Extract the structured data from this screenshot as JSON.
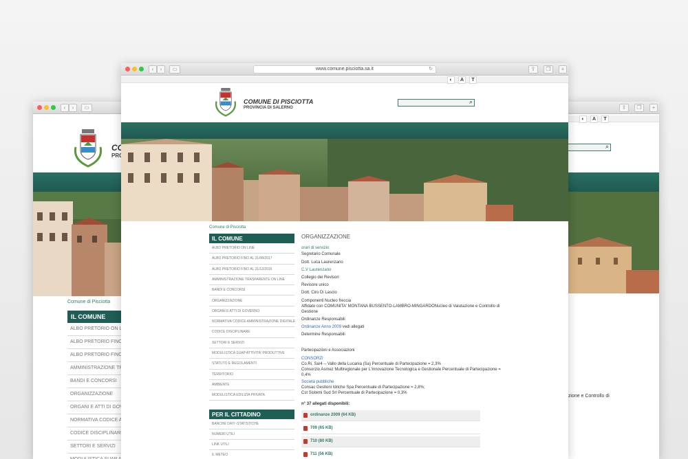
{
  "colors": {
    "accent": "#1e5e54",
    "teal": "#2b6f63",
    "link": "#2f7a6c",
    "link_blue": "#3567b5",
    "pdf": "#c23b2e"
  },
  "browser": {
    "url": "www.comune.pisciotta.sa.it",
    "reload_icon": "reload-icon",
    "share_icon": "share-icon",
    "tabs_icon": "tabs-icon",
    "new_tab_icon": "plus-icon"
  },
  "accessibility": {
    "contrast": "◐",
    "font": "A",
    "text": "T"
  },
  "header": {
    "title": "COMUNE DI PISCIOTTA",
    "subtitle": "PROVINCIA DI SALERNO"
  },
  "breadcrumb": "Comune di Pisciotta",
  "sidebar": {
    "heading": "IL COMUNE",
    "items": [
      "ALBO PRETORIO ON LINE",
      "ALBO PRETORIO FINO AL 31/08/2017",
      "ALBO PRETORIO FINO AL 31/12/2016",
      "AMMINISTRAZIONE TRASPARENTE ON LINE",
      "BANDI E CONCORSI",
      "ORGANIZZAZIONE",
      "ORGANI E ATTI DI GOVERNO",
      "NORMATIVA CODICE AMMINISTRAZIONE DIGITALE",
      "CODICE DISCIPLINARE",
      "SETTORI E SERVIZI",
      "MODULISTICA SUAP ATTIVITA' PRODUTTIVE",
      "STATUTO E REGOLAMENTI",
      "TERRITORIO",
      "AMBIENTE",
      "MODULISTICA EDILIZIA PRIVATA"
    ],
    "heading2": "PER IL CITTADINO",
    "items2": [
      "BANCHE DATI -STATISTICHE",
      "NUMERI UTILI",
      "LINK UTILI",
      "IL METEO"
    ]
  },
  "back_sidebar": {
    "heading": "IL COMUNE",
    "items": [
      "ALBO PRETORIO ON LINE",
      "ALBO PRETORIO FINO AL 31",
      "ALBO PRETORIO FINO AL 31",
      "AMMINISTRAZIONE TRASPA",
      "BANDI E CONCORSI",
      "ORGANIZZAZIONE",
      "ORGANI E ATTI DI GOVERNO",
      "NORMATIVA CODICE AMMIN",
      "CODICE DISCIPLINARE",
      "SETTORI E SERVIZI",
      "MODULISTICA SUAP ATTIV"
    ],
    "logo_text": "CO",
    "logo_sub": "PRO",
    "right_text": "tazione e Controllo di"
  },
  "content": {
    "title": "ORGANIZZAZIONE",
    "orari": "orari di servizio",
    "segretario": "Segretario Comunale",
    "laurenzano": "Dott. Luca Laurenzano",
    "cv": "C.V Laurenzano",
    "collegio": "Collegio dei Revisori",
    "revisore": "Revisore unico",
    "lascio": "Dott. Ciro Di Lascio",
    "nucleo": "Componenti Nucleo freccia",
    "affiliato1": "Affidato con COMUNITA' MONTANA BUSSENTO-LAMBRO-MINGARDONucleo di Valutazione e Controllo di",
    "affiliato2": "Gestione",
    "ordinanze_resp": "Ordinanze Responsabili",
    "ordinanze_anno": "Ordinanze Anno 2009",
    "vedi": " vedi allegati",
    "determine": "Determine Responsabili",
    "partecipazioni": "Partecipazioni e Associazioni",
    "consorzi": "CONSORZI",
    "cori": "Co.Ri. Sa/4 -- Vallo della Lucania (Sa) Percentuale di Partecipazione = 2,3%",
    "asmez1": "Consorzio Asmez Multiregionale per L'Innovazione Tecnologica e Gestionale Percentuale di Partecipazione =",
    "asmez2": "0,4%",
    "societa": "Società pubbliche",
    "consac": "Consac Gestioni Idriche Spa Percentuale di Partecipazione = 2,8%;",
    "cst": "Cst Sistemi Sud Srl Percentuale di Partecipazione = 0,3%",
    "allegati_count": "n° 37 allegati disponibili:",
    "attachments": [
      "ordinanze 2009 (64 KB)",
      "709 (65 KB)",
      "710 (80 KB)",
      "711 (56 KB)"
    ]
  }
}
